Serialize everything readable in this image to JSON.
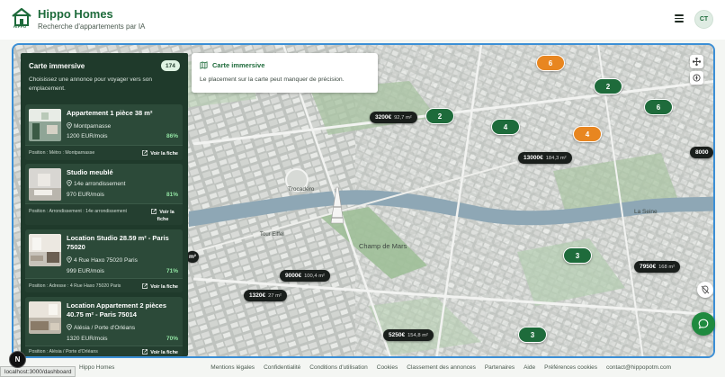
{
  "header": {
    "logo_text": "HIPPO",
    "title": "Hippo Homes",
    "subtitle": "Recherche d'appartements par IA",
    "avatar_initials": "CT"
  },
  "panel": {
    "title": "Carte immersive",
    "count": "174",
    "description": "Choisissez une annonce pour voyager vers son emplacement.",
    "cards": [
      {
        "title": "Appartement 1 pièce 38 m²",
        "location": "Montparnasse",
        "price": "1200 EUR/mois",
        "match": "86%",
        "position": "Position : Métro : Montparnasse",
        "link": "Voir la fiche"
      },
      {
        "title": "Studio meublé",
        "location": "14e arrondissement",
        "price": "970 EUR/mois",
        "match": "81%",
        "position": "Position : Arrondissement : 14e arrondissement",
        "link": "Voir la fiche"
      },
      {
        "title": "Location Studio 28.59 m² - Paris 75020",
        "location": "4 Rue Haxo 75020 Paris",
        "price": "999 EUR/mois",
        "match": "71%",
        "position": "Position : Adresse : 4 Rue Haxo 75020 Paris",
        "link": "Voir la fiche"
      },
      {
        "title": "Location Appartement 2 pièces 40.75 m² - Paris 75014",
        "location": "Alésia / Porte d'Orléans",
        "price": "1320 EUR/mois",
        "match": "70%",
        "position": "Position : Alésia / Porte d'Orléans",
        "link": "Voir la fiche"
      }
    ]
  },
  "info": {
    "title": "Carte immersive",
    "text": "Le placement sur la carte peut manquer de précision."
  },
  "map": {
    "labels": {
      "trocadero": "Trocadéro",
      "tour": "Tour Eiffel",
      "champ": "Champ de Mars",
      "seine": "La Seine"
    },
    "clusters": [
      {
        "label": "6",
        "color": "orange"
      },
      {
        "label": "2",
        "color": "green"
      },
      {
        "label": "2",
        "color": "green"
      },
      {
        "label": "4",
        "color": "green"
      },
      {
        "label": "6",
        "color": "green"
      },
      {
        "label": "4",
        "color": "orange"
      },
      {
        "label": "3",
        "color": "green"
      },
      {
        "label": "3",
        "color": "green"
      }
    ],
    "prices": [
      {
        "price": "3200€",
        "area": "92,7 m²"
      },
      {
        "price": "13000€",
        "area": "184,3 m²"
      },
      {
        "price": "8000",
        "area": ""
      },
      {
        "price": "7950€",
        "area": "168 m²"
      },
      {
        "price": "9000€",
        "area": "100,4 m²"
      },
      {
        "price": "1320€",
        "area": "27 m²"
      },
      {
        "price": "5250€",
        "area": "154,8 m²"
      },
      {
        "price": "m²",
        "area": ""
      }
    ]
  },
  "footer": {
    "brand": "Hippo Homes",
    "links": [
      "Mentions légales",
      "Confidentialité",
      "Conditions d'utilisation",
      "Cookies",
      "Classement des annonces",
      "Partenaires",
      "Aide",
      "Préférences cookies",
      "contact@hippopotm.com"
    ],
    "status_url": "localhost:3000/dashboard"
  },
  "colors": {
    "brand_green": "#1e6b3b",
    "panel_bg": "#1f3a2b",
    "cluster_green": "#1e6b3b",
    "cluster_orange": "#e88620",
    "map_border": "#3b8fd6"
  },
  "icons": [
    "house-logo-icon",
    "menu-icon",
    "pin-icon",
    "external-link-icon",
    "map-icon",
    "move-icon",
    "compass-icon",
    "hide-markers-icon",
    "chat-icon"
  ]
}
